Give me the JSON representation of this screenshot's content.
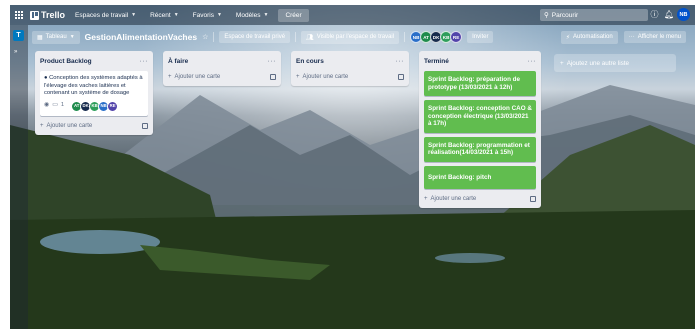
{
  "topbar": {
    "logo_text": "Trello",
    "nav": [
      {
        "label": "Espaces de travail"
      },
      {
        "label": "Récent"
      },
      {
        "label": "Favoris"
      },
      {
        "label": "Modèles"
      }
    ],
    "create_label": "Créer",
    "search_placeholder": "Parcourir",
    "user_initials": "NB"
  },
  "workspace": {
    "badge": "T"
  },
  "board": {
    "view_label": "Tableau",
    "title": "GestionAlimentationVaches",
    "workspace_private": "Espace de travail privé",
    "visibility_label": "Visible par l'espace de travail",
    "invite_label": "Inviter",
    "automation_label": "Automatisation",
    "menu_label": "Afficher le menu",
    "members": [
      {
        "initials": "NB",
        "color": "#2a6fc9"
      },
      {
        "initials": "AT",
        "color": "#1f8b4c"
      },
      {
        "initials": "DK",
        "color": "#172b4d"
      },
      {
        "initials": "KB",
        "color": "#2e9e5b"
      },
      {
        "initials": "RE",
        "color": "#5243aa"
      }
    ]
  },
  "lists": [
    {
      "title": "Product Backlog",
      "cards": [
        {
          "text": "● Conception des systèmes adaptés à l'élevage des vaches laitières et contenant un système de dosage",
          "watch_icon": "eye-icon",
          "comments": "1",
          "avatars": [
            {
              "initials": "AT",
              "color": "#1f8b4c"
            },
            {
              "initials": "DK",
              "color": "#172b4d"
            },
            {
              "initials": "KB",
              "color": "#2e9e5b"
            },
            {
              "initials": "NB",
              "color": "#2a6fc9"
            },
            {
              "initials": "RE",
              "color": "#5243aa"
            }
          ]
        }
      ],
      "add_label": "Ajouter une carte"
    },
    {
      "title": "À faire",
      "cards": [],
      "add_label": "Ajouter une carte"
    },
    {
      "title": "En cours",
      "cards": [],
      "add_label": "Ajouter une carte"
    },
    {
      "title": "Terminé",
      "cards": [
        {
          "text": "Sprint Backlog: préparation de prototype (13/03/2021 à 12h)"
        },
        {
          "text": "Sprint Backlog: conception CAO & conception électrique (13/03/2021 à 17h)"
        },
        {
          "text": "Sprint Backlog: programmation et réalisation(14/03/2021 à 15h)"
        },
        {
          "text": "Sprint Backlog: pitch"
        }
      ],
      "add_label": "Ajouter une carte"
    }
  ],
  "add_list_label": "Ajoutez une autre liste",
  "colors": {
    "card_green": "#61bd4f",
    "list_bg": "#ebecf0",
    "brand": "#0079bf"
  }
}
